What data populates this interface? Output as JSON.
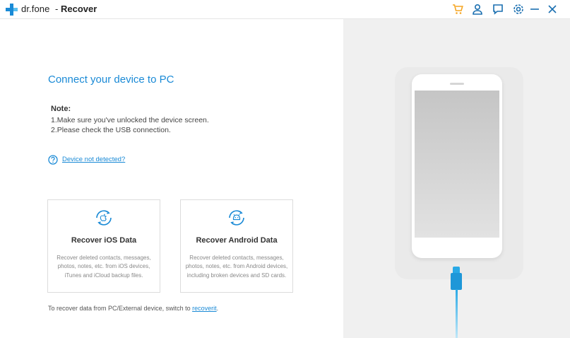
{
  "titlebar": {
    "app_brand": "dr.fone",
    "separator": "-",
    "page_title": "Recover",
    "icons": [
      "cart-icon",
      "account-icon",
      "feedback-icon",
      "settings-icon",
      "minimize-icon",
      "close-icon"
    ],
    "brand_color": "#1a8ad6",
    "cart_color": "#f5a623"
  },
  "main": {
    "heading": "Connect your device to PC",
    "note_label": "Note:",
    "note_lines": [
      "1.Make sure you've unlocked the device screen.",
      "2.Please check the USB connection."
    ],
    "help_link": "Device not detected?",
    "cards": [
      {
        "title": "Recover iOS Data",
        "icon": "ios-recover-icon",
        "description": "Recover deleted contacts, messages, photos, notes, etc. from iOS devices, iTunes and iCloud backup files."
      },
      {
        "title": "Recover Android Data",
        "icon": "android-recover-icon",
        "description": "Recover deleted contacts, messages, photos, notes, etc. from Android devices, including broken devices and SD cards."
      }
    ],
    "footer_text": "To recover data from PC/External device, switch to ",
    "footer_link": "recoverit",
    "footer_suffix": "."
  }
}
